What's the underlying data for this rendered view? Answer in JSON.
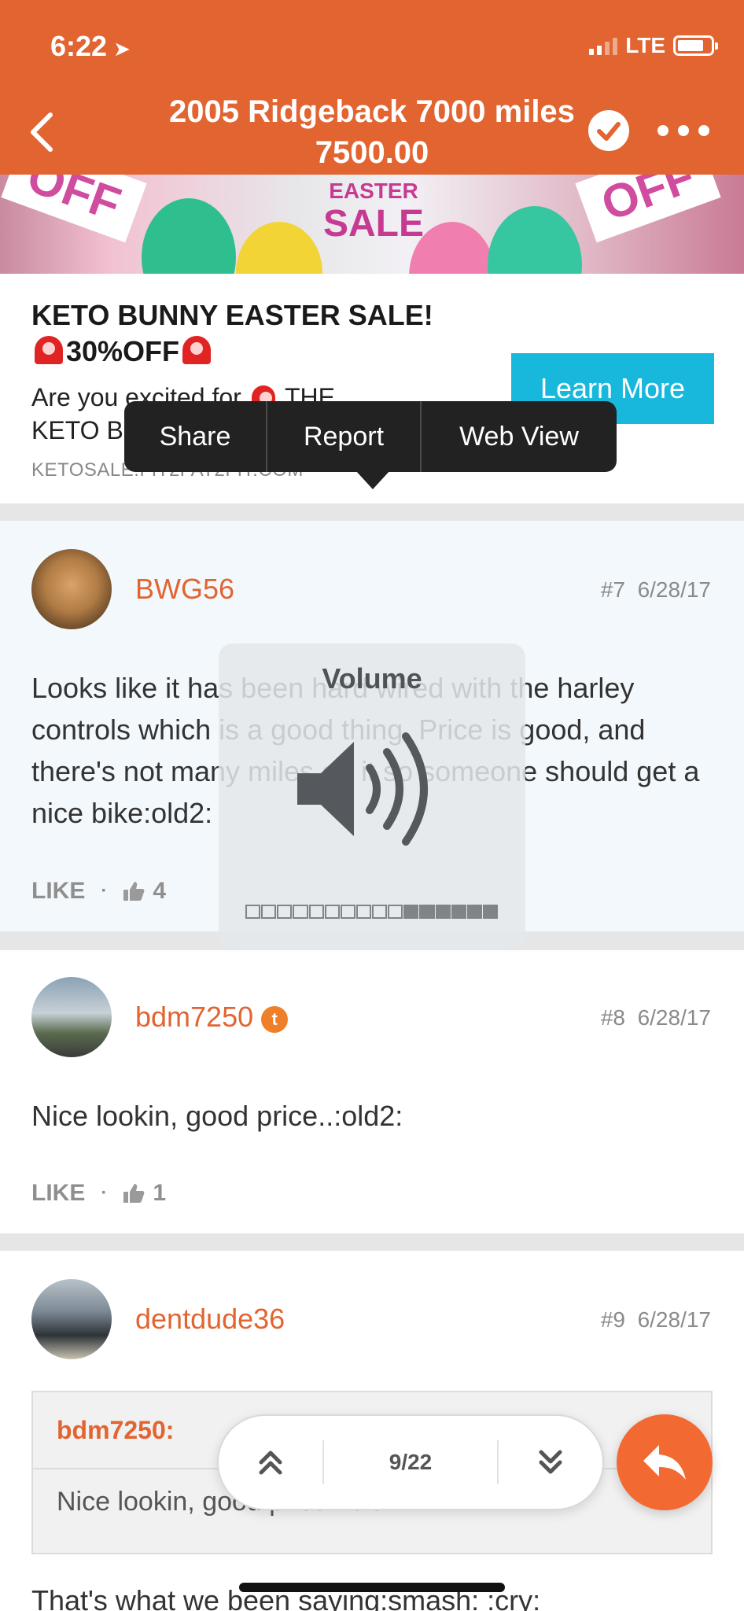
{
  "status_bar": {
    "time": "6:22",
    "network": "LTE"
  },
  "header": {
    "title": "2005 Ridgeback 7000 miles  7500.00"
  },
  "ad": {
    "banner_text": {
      "sale_top": "EASTER",
      "sale_bottom": "SALE",
      "off_left": "OFF",
      "off_right": "OFF"
    },
    "title_part1": "KETO BUNNY EASTER SALE!",
    "title_part2": "30%OFF",
    "body_part1": "Are you excited for",
    "body_part2": "THE",
    "body_line2": "KETO B",
    "domain": "KETOSALE.FIT2FAT2FIT.COM",
    "cta": "Learn More"
  },
  "context_menu": {
    "items": [
      "Share",
      "Report",
      "Web View"
    ]
  },
  "posts": [
    {
      "username": "BWG56",
      "number": "#7",
      "date": "6/28/17",
      "body": "Looks like it has been hard wired with the harley controls which is a good thing. Price is good, and there's not many miles on it so someone should get a nice bike:old2:",
      "like_label": "LIKE",
      "likes": "4"
    },
    {
      "username": "bdm7250",
      "badge": "t",
      "number": "#8",
      "date": "6/28/17",
      "body": "Nice lookin, good price..:old2:",
      "like_label": "LIKE",
      "likes": "1"
    },
    {
      "username": "dentdude36",
      "number": "#9",
      "date": "6/28/17",
      "quote_author": "bdm7250:",
      "quote_text": "Nice lookin, good price..:old2:",
      "body": "That's what we been saying:smash: :cry:"
    }
  ],
  "volume_hud": {
    "title": "Volume",
    "level": 0.62
  },
  "pager": {
    "count": "9/22"
  },
  "colors": {
    "accent": "#E26431",
    "ad_button": "#18B8DD",
    "fab": "#F26A32"
  }
}
